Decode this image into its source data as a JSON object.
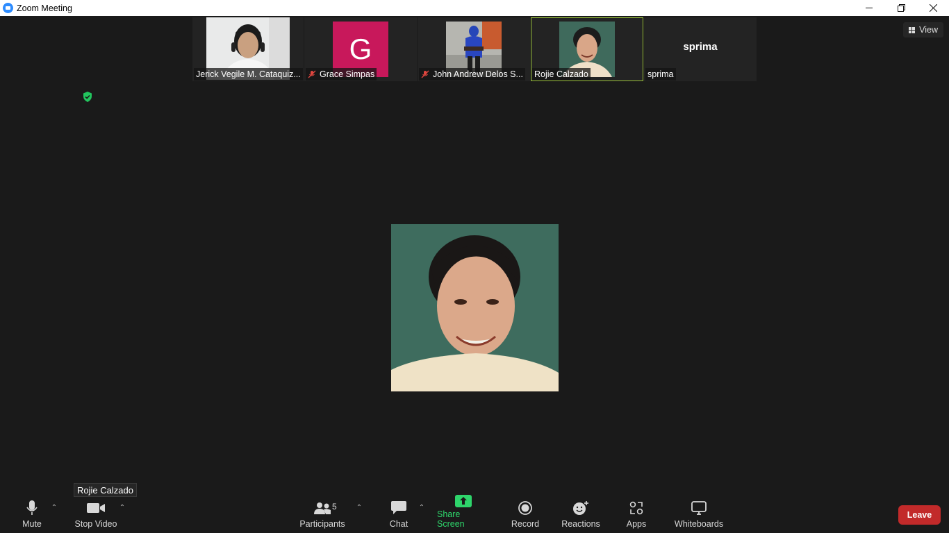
{
  "window": {
    "title": "Zoom Meeting",
    "controls": [
      "minimize",
      "restore",
      "close"
    ]
  },
  "filmstrip": [
    {
      "name": "Jerick Vegile M. Cataquiz...",
      "muted": false,
      "type": "video"
    },
    {
      "name": "Grace Simpas",
      "muted": true,
      "type": "initial",
      "initial": "G",
      "avatar_color": "#c8185b"
    },
    {
      "name": "John Andrew Delos S...",
      "muted": true,
      "type": "video"
    },
    {
      "name": "Rojie Calzado",
      "muted": false,
      "type": "video",
      "active": true
    },
    {
      "name": "sprima",
      "muted": false,
      "type": "name-only",
      "display_name": "sprima"
    }
  ],
  "view_button": {
    "label": "View"
  },
  "hover_label": "Rojie Calzado",
  "toolbar": {
    "mute": "Mute",
    "stop_video": "Stop Video",
    "participants": "Participants",
    "participants_count": "5",
    "chat": "Chat",
    "share_screen": "Share Screen",
    "record": "Record",
    "reactions": "Reactions",
    "apps": "Apps",
    "whiteboards": "Whiteboards",
    "leave": "Leave"
  },
  "colors": {
    "active_speaker_border": "#9bc23c",
    "share_green": "#2ed56b",
    "leave_red": "#c22a2a",
    "encryption_shield": "#22c55e"
  }
}
